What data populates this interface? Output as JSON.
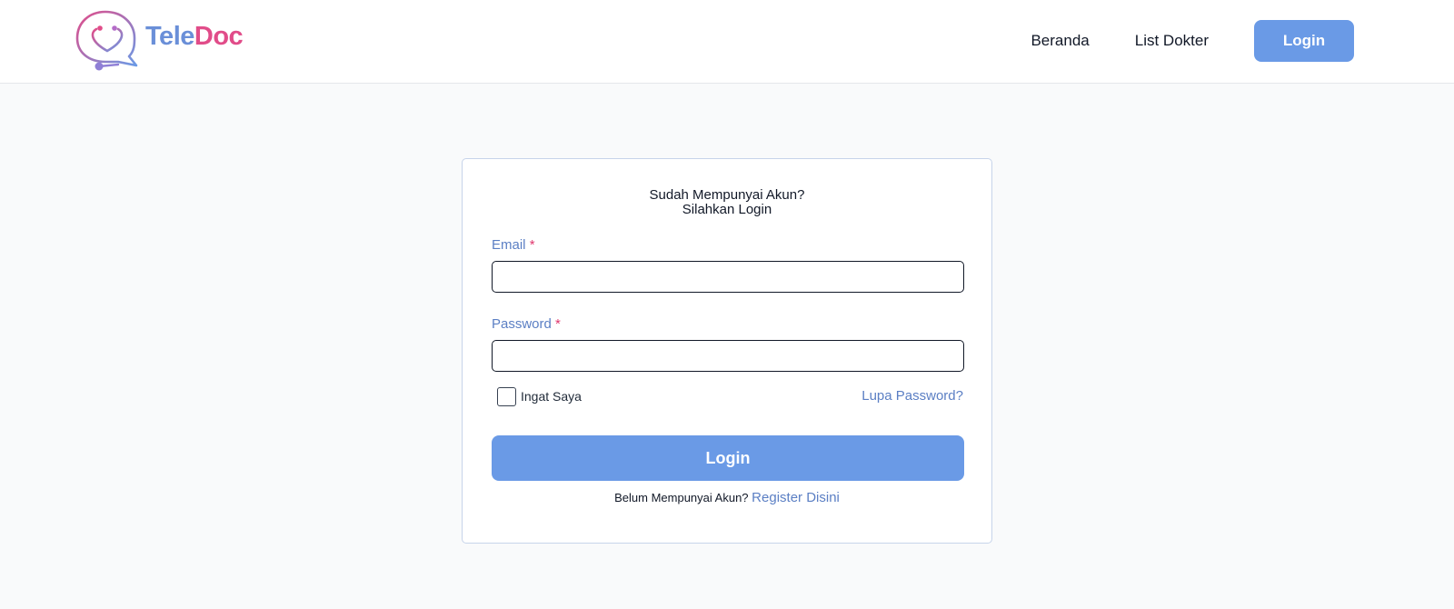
{
  "brand": {
    "name_part1": "Tele",
    "name_part2": "Doc",
    "logo_icon": "stethoscope-heart-chat-icon",
    "colors": {
      "blue": "#6a8fd8",
      "pink": "#e14c89"
    }
  },
  "nav": {
    "links": [
      "Beranda",
      "List Dokter"
    ],
    "login_label": "Login"
  },
  "login_form": {
    "title_line1": "Sudah Mempunyai Akun?",
    "title_line2": "Silahkan Login",
    "email": {
      "label": "Email",
      "required_mark": "*",
      "value": ""
    },
    "password": {
      "label": "Password",
      "required_mark": "*",
      "value": ""
    },
    "remember_label": "Ingat Saya",
    "remember_checked": false,
    "forgot_label": "Lupa Password?",
    "submit_label": "Login",
    "register_prompt": "Belum Mempunyai Akun?",
    "register_link": "Register Disini"
  },
  "theme": {
    "accent": "#6a9ae6",
    "link": "#5b7fc4",
    "required": "#e0386e",
    "background": "#f9fafb"
  }
}
